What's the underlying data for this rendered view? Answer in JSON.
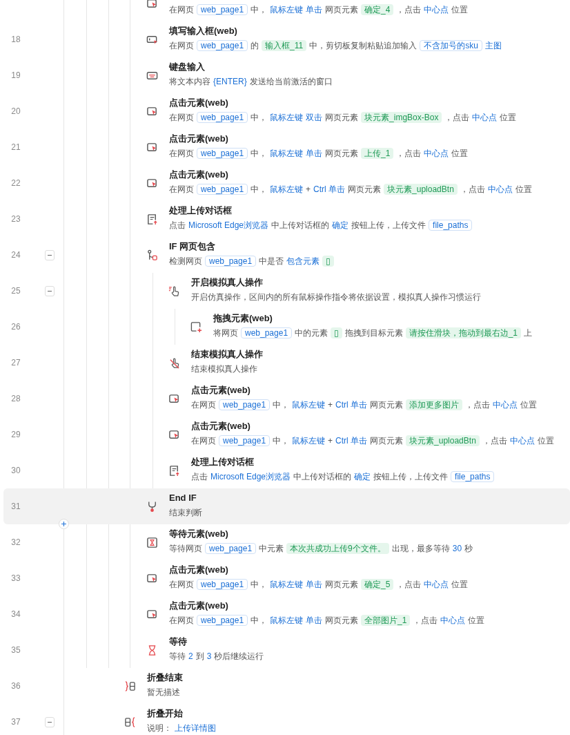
{
  "steps": [
    {
      "kind": "group",
      "children": [
        {
          "kind": "click",
          "partial": true,
          "selected": false,
          "desc": [
            {
              "kind": "text",
              "text": "在网页"
            },
            {
              "kind": "var",
              "text": "web_page1"
            },
            {
              "kind": "text",
              "text": "中，"
            },
            {
              "kind": "kw",
              "text": "鼠标左键"
            },
            {
              "kind": "kw",
              "text": "单击"
            },
            {
              "kind": "text",
              "text": "网页元素"
            },
            {
              "kind": "elem",
              "text": "确定_4"
            },
            {
              "kind": "text",
              "text": "，点击"
            },
            {
              "kind": "kw",
              "text": "中心点"
            },
            {
              "kind": "text",
              "text": "位置"
            }
          ]
        },
        {
          "kind": "input",
          "number": "18",
          "title": "填写输入框(web)",
          "selected": false,
          "desc": [
            {
              "kind": "text",
              "text": "在网页"
            },
            {
              "kind": "var",
              "text": "web_page1"
            },
            {
              "kind": "text",
              "text": "的"
            },
            {
              "kind": "elem",
              "text": "输入框_11"
            },
            {
              "kind": "text",
              "text": "中，剪切板复制粘贴追加输入"
            },
            {
              "kind": "var",
              "text": "不含加号的sku"
            },
            {
              "kind": "kw",
              "text": "主图"
            }
          ]
        },
        {
          "kind": "keyboard",
          "number": "19",
          "title": "键盘输入",
          "selected": false,
          "desc": [
            {
              "kind": "text",
              "text": "将文本内容"
            },
            {
              "kind": "kw",
              "text": "{ENTER}"
            },
            {
              "kind": "text",
              "text": "发送给当前激活的窗口"
            }
          ]
        },
        {
          "kind": "click",
          "number": "20",
          "title": "点击元素(web)",
          "selected": false,
          "desc": [
            {
              "kind": "text",
              "text": "在网页"
            },
            {
              "kind": "var",
              "text": "web_page1"
            },
            {
              "kind": "text",
              "text": "中，"
            },
            {
              "kind": "kw",
              "text": "鼠标左键"
            },
            {
              "kind": "kw",
              "text": "双击"
            },
            {
              "kind": "text",
              "text": "网页元素"
            },
            {
              "kind": "elem",
              "text": "块元素_imgBox-Box"
            },
            {
              "kind": "text",
              "text": "，点击"
            },
            {
              "kind": "kw",
              "text": "中心点"
            },
            {
              "kind": "text",
              "text": "位置"
            }
          ]
        },
        {
          "kind": "click",
          "number": "21",
          "title": "点击元素(web)",
          "selected": false,
          "desc": [
            {
              "kind": "text",
              "text": "在网页"
            },
            {
              "kind": "var",
              "text": "web_page1"
            },
            {
              "kind": "text",
              "text": "中，"
            },
            {
              "kind": "kw",
              "text": "鼠标左键"
            },
            {
              "kind": "kw",
              "text": "单击"
            },
            {
              "kind": "text",
              "text": "网页元素"
            },
            {
              "kind": "elem",
              "text": "上传_1"
            },
            {
              "kind": "text",
              "text": "，点击"
            },
            {
              "kind": "kw",
              "text": "中心点"
            },
            {
              "kind": "text",
              "text": "位置"
            }
          ]
        },
        {
          "kind": "click",
          "number": "22",
          "title": "点击元素(web)",
          "selected": false,
          "desc": [
            {
              "kind": "text",
              "text": "在网页"
            },
            {
              "kind": "var",
              "text": "web_page1"
            },
            {
              "kind": "text",
              "text": "中，"
            },
            {
              "kind": "kw",
              "text": "鼠标左键"
            },
            {
              "kind": "text",
              "text": "+"
            },
            {
              "kind": "kw",
              "text": "Ctrl 单击"
            },
            {
              "kind": "text",
              "text": "网页元素"
            },
            {
              "kind": "elem",
              "text": "块元素_uploadBtn"
            },
            {
              "kind": "text",
              "text": "，点击"
            },
            {
              "kind": "kw",
              "text": "中心点"
            },
            {
              "kind": "text",
              "text": "位置"
            }
          ]
        },
        {
          "kind": "upload",
          "number": "23",
          "title": "处理上传对话框",
          "selected": false,
          "desc": [
            {
              "kind": "text",
              "text": "点击"
            },
            {
              "kind": "kw",
              "text": "Microsoft Edge浏览器"
            },
            {
              "kind": "text",
              "text": "中上传对话框的"
            },
            {
              "kind": "kw",
              "text": "确定"
            },
            {
              "kind": "text",
              "text": "按钮上传，上传文件"
            },
            {
              "kind": "var",
              "text": "file_paths"
            }
          ]
        },
        {
          "kind": "if",
          "number": "24",
          "title": "IF 网页包含",
          "selected": false,
          "expanded": true,
          "desc": [
            {
              "kind": "text",
              "text": "检测网页"
            },
            {
              "kind": "var",
              "text": "web_page1"
            },
            {
              "kind": "text",
              "text": "中是否"
            },
            {
              "kind": "kw",
              "text": "包含元素"
            },
            {
              "kind": "elem",
              "text": "▯"
            }
          ],
          "children": [
            {
              "kind": "sim-start",
              "number": "25",
              "title": "开启模拟真人操作",
              "selected": false,
              "expanded": true,
              "desc": [
                {
                  "kind": "text",
                  "text": "开启仿真操作，区间内的所有鼠标操作指令将依据设置，模拟真人操作习惯运行"
                }
              ],
              "children": [
                {
                  "kind": "drag",
                  "number": "26",
                  "title": "拖拽元素(web)",
                  "selected": false,
                  "desc": [
                    {
                      "kind": "text",
                      "text": "将网页"
                    },
                    {
                      "kind": "var",
                      "text": "web_page1"
                    },
                    {
                      "kind": "text",
                      "text": "中的元素"
                    },
                    {
                      "kind": "elem",
                      "text": "▯"
                    },
                    {
                      "kind": "text",
                      "text": "拖拽到目标元素"
                    },
                    {
                      "kind": "elem",
                      "text": "请按住滑块，拖动到最右边_1"
                    },
                    {
                      "kind": "text",
                      "text": "上"
                    }
                  ]
                }
              ]
            },
            {
              "kind": "sim-end",
              "number": "27",
              "title": "结束模拟真人操作",
              "selected": false,
              "desc": [
                {
                  "kind": "text",
                  "text": "结束模拟真人操作"
                }
              ]
            },
            {
              "kind": "click",
              "number": "28",
              "title": "点击元素(web)",
              "selected": false,
              "desc": [
                {
                  "kind": "text",
                  "text": "在网页"
                },
                {
                  "kind": "var",
                  "text": "web_page1"
                },
                {
                  "kind": "text",
                  "text": "中，"
                },
                {
                  "kind": "kw",
                  "text": "鼠标左键"
                },
                {
                  "kind": "text",
                  "text": "+"
                },
                {
                  "kind": "kw",
                  "text": "Ctrl 单击"
                },
                {
                  "kind": "text",
                  "text": "网页元素"
                },
                {
                  "kind": "elem",
                  "text": "添加更多图片"
                },
                {
                  "kind": "text",
                  "text": "，点击"
                },
                {
                  "kind": "kw",
                  "text": "中心点"
                },
                {
                  "kind": "text",
                  "text": "位置"
                }
              ]
            },
            {
              "kind": "click",
              "number": "29",
              "title": "点击元素(web)",
              "selected": false,
              "desc": [
                {
                  "kind": "text",
                  "text": "在网页"
                },
                {
                  "kind": "var",
                  "text": "web_page1"
                },
                {
                  "kind": "text",
                  "text": "中，"
                },
                {
                  "kind": "kw",
                  "text": "鼠标左键"
                },
                {
                  "kind": "text",
                  "text": "+"
                },
                {
                  "kind": "kw",
                  "text": "Ctrl 单击"
                },
                {
                  "kind": "text",
                  "text": "网页元素"
                },
                {
                  "kind": "elem",
                  "text": "块元素_uploadBtn"
                },
                {
                  "kind": "text",
                  "text": "，点击"
                },
                {
                  "kind": "kw",
                  "text": "中心点"
                },
                {
                  "kind": "text",
                  "text": "位置"
                }
              ]
            },
            {
              "kind": "upload",
              "number": "30",
              "title": "处理上传对话框",
              "selected": false,
              "desc": [
                {
                  "kind": "text",
                  "text": "点击"
                },
                {
                  "kind": "kw",
                  "text": "Microsoft Edge浏览器"
                },
                {
                  "kind": "text",
                  "text": "中上传对话框的"
                },
                {
                  "kind": "kw",
                  "text": "确定"
                },
                {
                  "kind": "text",
                  "text": "按钮上传，上传文件"
                },
                {
                  "kind": "var",
                  "text": "file_paths"
                }
              ]
            }
          ]
        },
        {
          "kind": "endif",
          "number": "31",
          "title": "End IF",
          "selected": true,
          "insert_button": true,
          "desc": [
            {
              "kind": "text",
              "text": "结束判断"
            }
          ]
        },
        {
          "kind": "wait-element",
          "number": "32",
          "title": "等待元素(web)",
          "selected": false,
          "desc": [
            {
              "kind": "text",
              "text": "等待网页"
            },
            {
              "kind": "var",
              "text": "web_page1"
            },
            {
              "kind": "text",
              "text": "中元素"
            },
            {
              "kind": "elem",
              "text": "本次共成功上传9个文件。"
            },
            {
              "kind": "text",
              "text": "出现，最多等待"
            },
            {
              "kind": "kw",
              "text": "30"
            },
            {
              "kind": "text",
              "text": "秒"
            }
          ]
        },
        {
          "kind": "click",
          "number": "33",
          "title": "点击元素(web)",
          "selected": false,
          "desc": [
            {
              "kind": "text",
              "text": "在网页"
            },
            {
              "kind": "var",
              "text": "web_page1"
            },
            {
              "kind": "text",
              "text": "中，"
            },
            {
              "kind": "kw",
              "text": "鼠标左键"
            },
            {
              "kind": "kw",
              "text": "单击"
            },
            {
              "kind": "text",
              "text": "网页元素"
            },
            {
              "kind": "elem",
              "text": "确定_5"
            },
            {
              "kind": "text",
              "text": "，点击"
            },
            {
              "kind": "kw",
              "text": "中心点"
            },
            {
              "kind": "text",
              "text": "位置"
            }
          ]
        },
        {
          "kind": "click",
          "number": "34",
          "title": "点击元素(web)",
          "selected": false,
          "desc": [
            {
              "kind": "text",
              "text": "在网页"
            },
            {
              "kind": "var",
              "text": "web_page1"
            },
            {
              "kind": "text",
              "text": "中，"
            },
            {
              "kind": "kw",
              "text": "鼠标左键"
            },
            {
              "kind": "kw",
              "text": "单击"
            },
            {
              "kind": "text",
              "text": "网页元素"
            },
            {
              "kind": "elem",
              "text": "全部图片_1"
            },
            {
              "kind": "text",
              "text": "，点击"
            },
            {
              "kind": "kw",
              "text": "中心点"
            },
            {
              "kind": "text",
              "text": "位置"
            }
          ]
        },
        {
          "kind": "wait",
          "number": "35",
          "title": "等待",
          "selected": false,
          "desc": [
            {
              "kind": "text",
              "text": "等待"
            },
            {
              "kind": "kw",
              "text": "2"
            },
            {
              "kind": "text",
              "text": "到"
            },
            {
              "kind": "kw",
              "text": "3"
            },
            {
              "kind": "text",
              "text": "秒后继续运行"
            }
          ]
        }
      ]
    },
    {
      "kind": "fold-end",
      "number": "36",
      "title": "折叠结束",
      "selected": false,
      "desc": [
        {
          "kind": "text",
          "text": "暂无描述"
        }
      ]
    },
    {
      "kind": "fold-start",
      "number": "37",
      "title": "折叠开始",
      "selected": false,
      "expanded": true,
      "desc": [
        {
          "kind": "text",
          "text": "说明："
        },
        {
          "kind": "kw",
          "text": "上传详情图"
        }
      ]
    }
  ]
}
